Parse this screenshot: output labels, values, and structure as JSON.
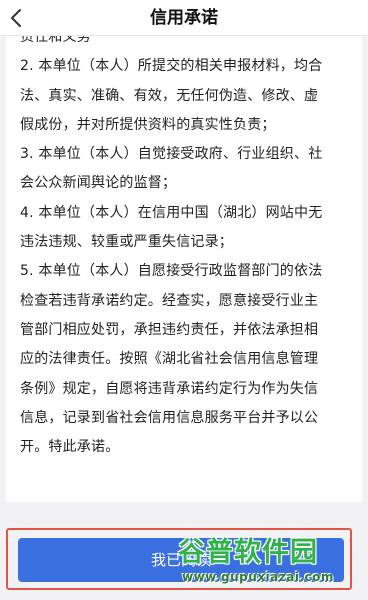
{
  "header": {
    "title": "信用承诺",
    "back_icon": "chevron-left-icon"
  },
  "content": {
    "lines": [
      "责任和义务",
      "2. 本单位（本人）所提交的相关申报材料，均合",
      "法、真实、准确、有效，无任何伪造、修改、虚",
      "假成份，并对所提供资料的真实性负责；",
      "3. 本单位（本人）自觉接受政府、行业组织、社",
      "会公众新闻舆论的监督；",
      "4. 本单位（本人）在信用中国（湖北）网站中无",
      "违法违规、较重或严重失信记录；",
      "5. 本单位（本人）自愿接受行政监督部门的依法",
      "检查若违背承诺约定。经查实，愿意接受行业主",
      "管部门相应处罚，承担违约责任，并依法承担相",
      "应的法律责任。按照《湖北省社会信用信息管理",
      "条例》规定，自愿将违背承诺约定行为作为失信",
      "信息，记录到省社会信用信息服务平台并予以公",
      "开。特此承诺。"
    ]
  },
  "footer": {
    "button_label": "我已阅读",
    "highlight_color": "#e05545",
    "button_color": "#3a6fe0"
  },
  "watermark": {
    "logo_text": "谷普软件园",
    "url": "www.gupuxiazai.com"
  }
}
